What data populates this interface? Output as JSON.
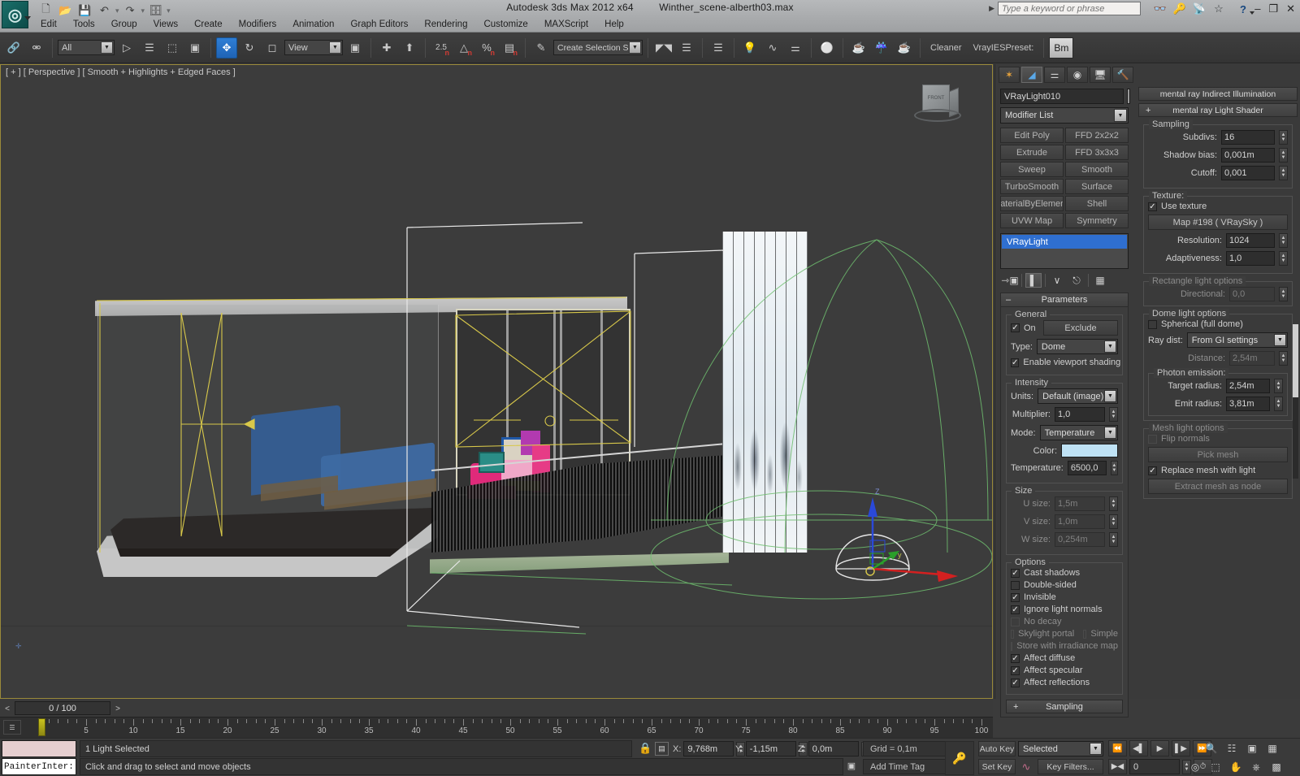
{
  "titlebar": {
    "app_title": "Autodesk 3ds Max  2012 x64",
    "file_name": "Winther_scene-alberth03.max",
    "search_placeholder": "Type a keyword or phrase",
    "quick_access": [
      "new-icon",
      "open-icon",
      "save-icon",
      "undo-icon",
      "redo-icon",
      "setproject-icon"
    ],
    "icons": [
      "binoculars-icon",
      "key-icon",
      "satellite-icon",
      "star-icon"
    ],
    "help_label": "?",
    "window_controls": [
      "minimize",
      "restore",
      "close"
    ]
  },
  "menu": {
    "items": [
      "Edit",
      "Tools",
      "Group",
      "Views",
      "Create",
      "Modifiers",
      "Animation",
      "Graph Editors",
      "Rendering",
      "Customize",
      "MAXScript",
      "Help"
    ]
  },
  "toolbar": {
    "selection_filter": "All",
    "reference_coord": "View",
    "named_selection_sets": "Create Selection Set",
    "cleaner_label": "Cleaner",
    "vray_preset_label": "VrayIESPreset:",
    "bm_label": "Bm",
    "snap_values": [
      "2.5",
      "angle",
      "%",
      "spinner"
    ],
    "icons": [
      "link-icon",
      "unlink-icon",
      "select-object-icon",
      "select-by-name-icon",
      "rectangle-select-icon",
      "window-crossing-icon",
      "select-move-icon",
      "select-rotate-icon",
      "select-scale-icon",
      "mirror-icon",
      "align-icon",
      "layer-manager-icon",
      "graph-editor-icon",
      "curve-editor-icon",
      "schematic-view-icon",
      "material-editor-icon",
      "render-setup-icon",
      "rendered-frame-icon",
      "render-production-icon"
    ]
  },
  "viewport": {
    "label": "[ + ] [ Perspective ] [ Smooth + Highlights + Edged Faces ]",
    "viewcube_face": "FRONT",
    "gizmo_axes": [
      "Z",
      "Y",
      "X"
    ]
  },
  "command_panel": {
    "tabs": [
      "create-tab",
      "modify-tab",
      "hierarchy-tab",
      "motion-tab",
      "display-tab",
      "utilities-tab"
    ],
    "selected_tab_index": 1,
    "object_name": "VRayLight010",
    "modifier_list_label": "Modifier List",
    "modifier_buttons": [
      "Edit Poly",
      "FFD 2x2x2",
      "Extrude",
      "FFD 3x3x3",
      "Sweep",
      "Smooth",
      "TurboSmooth",
      "Surface",
      "aterialByElemer",
      "Shell",
      "UVW Map",
      "Symmetry"
    ],
    "stack_entry": "VRayLight",
    "stack_icons": [
      "pin-stack-icon",
      "show-end-result-icon",
      "make-unique-icon",
      "remove-modifier-icon",
      "configure-sets-icon"
    ],
    "parameters": {
      "rollout_title": "Parameters",
      "general": {
        "legend": "General",
        "on_label": "On",
        "on_checked": true,
        "exclude_label": "Exclude",
        "type_label": "Type:",
        "type_value": "Dome",
        "viewport_shading_label": "Enable viewport shading",
        "viewport_shading_checked": true
      },
      "intensity": {
        "legend": "Intensity",
        "units_label": "Units:",
        "units_value": "Default (image)",
        "multiplier_label": "Multiplier:",
        "multiplier_value": "1,0",
        "mode_label": "Mode:",
        "mode_value": "Temperature",
        "color_label": "Color:",
        "color_value": "#bfe2f5",
        "temperature_label": "Temperature:",
        "temperature_value": "6500,0"
      },
      "size": {
        "legend": "Size",
        "u_label": "U size:",
        "u_value": "1,5m",
        "v_label": "V size:",
        "v_value": "1,0m",
        "w_label": "W size:",
        "w_value": "0,254m"
      },
      "options": {
        "legend": "Options",
        "items": [
          {
            "label": "Cast shadows",
            "checked": true,
            "enabled": true
          },
          {
            "label": "Double-sided",
            "checked": false,
            "enabled": true
          },
          {
            "label": "Invisible",
            "checked": true,
            "enabled": true
          },
          {
            "label": "Ignore light normals",
            "checked": true,
            "enabled": true
          },
          {
            "label": "No decay",
            "checked": false,
            "enabled": false
          },
          {
            "label": "Skylight portal",
            "checked": false,
            "enabled": false
          },
          {
            "label": "Store with irradiance map",
            "checked": false,
            "enabled": false
          },
          {
            "label": "Affect diffuse",
            "checked": true,
            "enabled": true
          },
          {
            "label": "Affect specular",
            "checked": true,
            "enabled": true
          },
          {
            "label": "Affect reflections",
            "checked": true,
            "enabled": true
          }
        ],
        "next_rollout_label": "Sampling"
      }
    },
    "right_column": {
      "rollouts": [
        {
          "label": "mental ray Indirect Illumination",
          "sign": ""
        },
        {
          "label": "mental ray Light Shader",
          "sign": "+"
        }
      ],
      "sampling": {
        "legend": "Sampling",
        "subdivs_label": "Subdivs:",
        "subdivs_value": "16",
        "shadow_bias_label": "Shadow bias:",
        "shadow_bias_value": "0,001m",
        "cutoff_label": "Cutoff:",
        "cutoff_value": "0,001"
      },
      "texture": {
        "legend": "Texture:",
        "use_texture_label": "Use texture",
        "use_texture_checked": true,
        "map_button": "Map #198  ( VRaySky )",
        "resolution_label": "Resolution:",
        "resolution_value": "1024",
        "adaptiveness_label": "Adaptiveness:",
        "adaptiveness_value": "1,0"
      },
      "rectangle_light": {
        "legend": "Rectangle light options",
        "directional_label": "Directional:",
        "directional_value": "0,0"
      },
      "dome_light": {
        "legend": "Dome light options",
        "spherical_label": "Spherical (full dome)",
        "spherical_checked": false,
        "ray_dist_label": "Ray dist:",
        "ray_dist_value": "From GI settings",
        "distance_label": "Distance:",
        "distance_value": "2,54m",
        "photon_legend": "Photon emission:",
        "target_radius_label": "Target radius:",
        "target_radius_value": "2,54m",
        "emit_radius_label": "Emit radius:",
        "emit_radius_value": "3,81m"
      },
      "mesh_light": {
        "legend": "Mesh light options",
        "flip_normals_label": "Flip normals",
        "flip_normals_checked": false,
        "pick_mesh_label": "Pick mesh",
        "replace_mesh_label": "Replace mesh with light",
        "replace_mesh_checked": true,
        "extract_mesh_label": "Extract mesh as node"
      }
    }
  },
  "time_slider": {
    "frame_label": "0 / 100",
    "prev_arrow": "<",
    "next_arrow": ">"
  },
  "track_bar": {
    "tick_labels": [
      "5",
      "10",
      "15",
      "20",
      "25",
      "30",
      "35",
      "40",
      "45",
      "50",
      "55",
      "60",
      "65",
      "70",
      "75",
      "80",
      "85",
      "90",
      "95",
      "100"
    ],
    "max_frame": 100
  },
  "status": {
    "listener_text": "PainterInter:",
    "selection_text": "1 Light Selected",
    "prompt_text": "Click and drag to select and move objects",
    "x_label": "X:",
    "x_value": "9,768m",
    "y_label": "Y:",
    "y_value": "-1,15m",
    "z_label": "Z:",
    "z_value": "0,0m",
    "grid_label": "Grid = 0,1m",
    "add_time_tag": "Add Time Tag",
    "auto_key": "Auto Key",
    "set_key": "Set Key",
    "key_mode": "Selected",
    "key_filters": "Key Filters...",
    "current_frame": "0",
    "playback_icons": [
      "go-to-start-icon",
      "previous-frame-icon",
      "play-icon",
      "next-frame-icon",
      "go-to-end-icon"
    ],
    "nav_icons_row1": [
      "zoom-icon",
      "zoom-all-icon",
      "zoom-extents-icon",
      "zoom-extents-all-icon"
    ],
    "nav_icons_row2": [
      "field-of-view-icon",
      "region-zoom-icon",
      "pan-icon",
      "orbit-icon",
      "maximize-viewport-icon"
    ],
    "key_icon": "key-icon"
  }
}
